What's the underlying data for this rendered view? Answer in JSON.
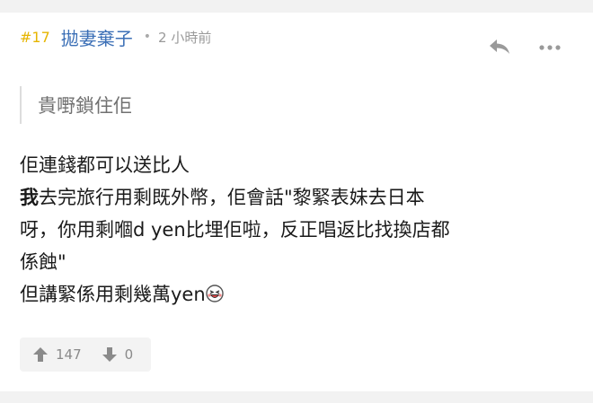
{
  "comment": {
    "floor": "#17",
    "author": "拋妻棄子",
    "separator": "•",
    "time": "2 小時前",
    "quote": "貴嘢鎖住佢",
    "body_line1": "佢連錢都可以送比人",
    "body_line2_bold": "我",
    "body_line2_rest": "去完旅行用剩既外幣，佢會話\"黎緊表妹去日本",
    "body_line3": "呀，你用剩嗰d yen比埋佢啦，反正唱返比找換店都",
    "body_line4": "係蝕\"",
    "body_line5": "但講緊係用剩幾萬yen",
    "emoji_icon": "laughing-face-icon",
    "upvotes": "147",
    "downvotes": "0"
  },
  "colors": {
    "floor": "#e6b500",
    "author": "#3b6fb6",
    "meta": "#9a9a9a",
    "background": "#f2f2f2"
  }
}
